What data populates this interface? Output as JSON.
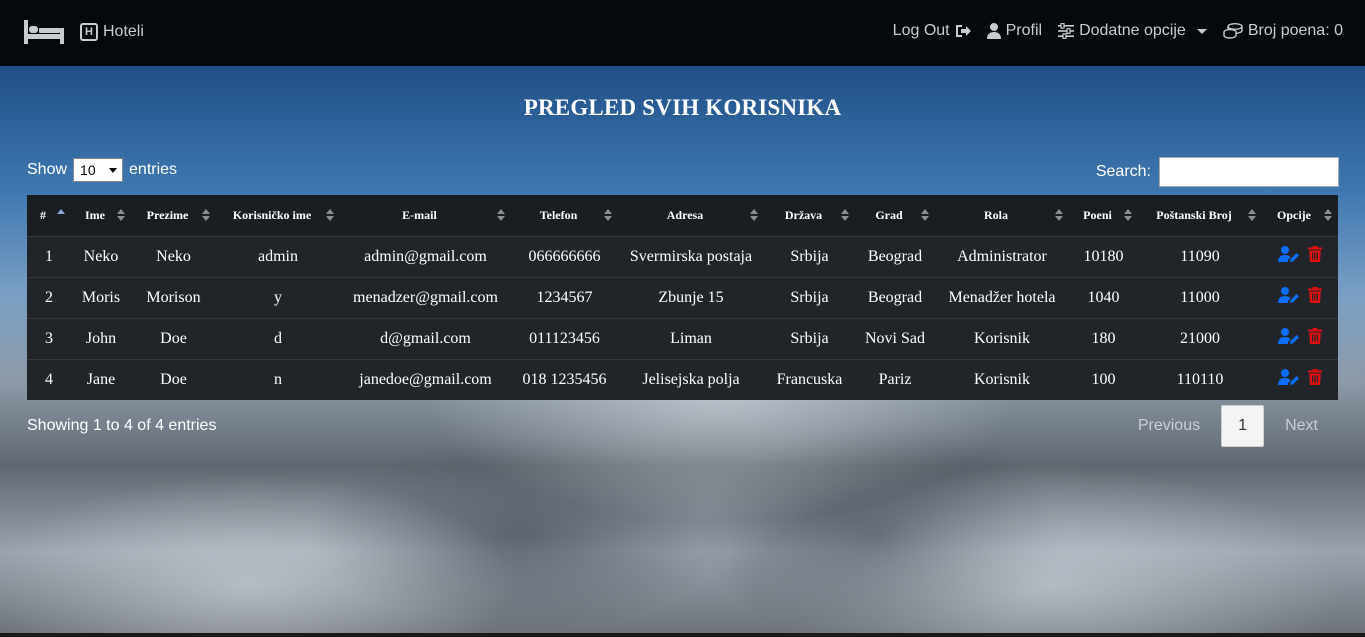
{
  "colors": {
    "navbar_bg": "#05080c",
    "table_bg": "#212529",
    "edit_icon": "#0d6efd",
    "delete_icon": "#e01010"
  },
  "navbar": {
    "brand_icon": "bed-icon",
    "hotels_label": "Hoteli",
    "logout_label": "Log Out",
    "profile_label": "Profil",
    "extra_options_label": "Dodatne opcije",
    "points_label": "Broj poena: 0"
  },
  "page": {
    "title": "PREGLED SVIH KORISNIKA"
  },
  "controls": {
    "show_label": "Show",
    "entries_label": "entries",
    "page_length": "10",
    "search_label": "Search:",
    "search_value": ""
  },
  "table": {
    "headers": [
      "#",
      "Ime",
      "Prezime",
      "Korisničko ime",
      "E-mail",
      "Telefon",
      "Adresa",
      "Država",
      "Grad",
      "Rola",
      "Poeni",
      "Poštanski Broj",
      "Opcije"
    ],
    "rows": [
      [
        "1",
        "Neko",
        "Neko",
        "admin",
        "admin@gmail.com",
        "066666666",
        "Svermirska postaja",
        "Srbija",
        "Beograd",
        "Administrator",
        "10180",
        "11090"
      ],
      [
        "2",
        "Moris",
        "Morison",
        "y",
        "menadzer@gmail.com",
        "1234567",
        "Zbunje 15",
        "Srbija",
        "Beograd",
        "Menadžer hotela",
        "1040",
        "11000"
      ],
      [
        "3",
        "John",
        "Doe",
        "d",
        "d@gmail.com",
        "011123456",
        "Liman",
        "Srbija",
        "Novi Sad",
        "Korisnik",
        "180",
        "21000"
      ],
      [
        "4",
        "Jane",
        "Doe",
        "n",
        "janedoe@gmail.com",
        "018 1235456",
        "Jelisejska polja",
        "Francuska",
        "Pariz",
        "Korisnik",
        "100",
        "110110"
      ]
    ]
  },
  "footer": {
    "info": "Showing 1 to 4 of 4 entries",
    "previous": "Previous",
    "current_page": "1",
    "next": "Next"
  }
}
